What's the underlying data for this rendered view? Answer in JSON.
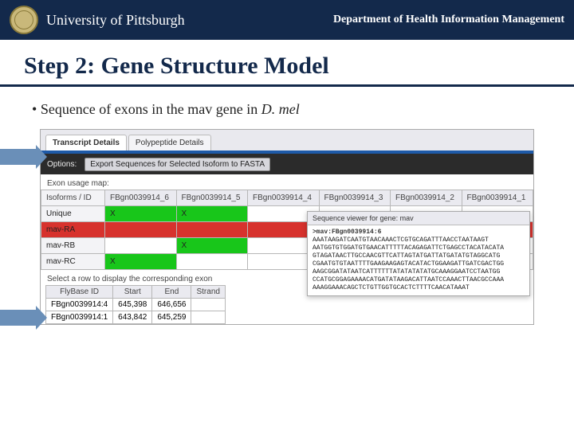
{
  "header": {
    "university": "University of Pittsburgh",
    "department": "Department of Health Information Management"
  },
  "slide": {
    "title": "Step 2: Gene Structure Model",
    "bullet_prefix": "• ",
    "bullet_text": "Sequence of exons in the mav gene in ",
    "bullet_italic": "D. mel"
  },
  "panel": {
    "tabs": {
      "active": "Transcript Details",
      "other": "Polypeptide Details"
    },
    "options_label": "Options:",
    "options_button": "Export Sequences for Selected Isoform to FASTA",
    "exon_map_label": "Exon usage map:",
    "columns": {
      "c0": "Isoforms / ID",
      "c1": "FBgn0039914_6",
      "c2": "FBgn0039914_5",
      "c3": "FBgn0039914_4",
      "c4": "FBgn0039914_3",
      "c5": "FBgn0039914_2",
      "c6": "FBgn0039914_1"
    },
    "rows": {
      "unique": "Unique",
      "ra": "mav-RA",
      "rb": "mav-RB",
      "rc": "mav-RC"
    },
    "marks": {
      "x": "X"
    },
    "select_label": "Select a row to display the corresponding exon",
    "sub": {
      "h1": "FlyBase ID",
      "h2": "Start",
      "h3": "End",
      "h4": "Strand",
      "r1c1": "FBgn0039914:4",
      "r1c2": "645,398",
      "r1c3": "646,656",
      "r2c1": "FBgn0039914:1",
      "r2c2": "643,842",
      "r2c3": "645,259"
    },
    "viewer": {
      "title": "Sequence viewer for gene: mav",
      "fasta_header": ">mav:FBgn0039914:6",
      "l1": "AAATAAGATCAATGTAACAAACTCGTGCAGATTTAACCTAATAAGT",
      "l2": "AATGGTGTGGATGTGAACATTTTTACAGAGATTCTGAGCCTACATACATA",
      "l3": "GTAGATAACTTGCCAACGTTCATTAGTATGATTATGATATGTAGGCATG",
      "l4": "CGAATGTGTAATTTTGAAGAAGAGTACATACTGGAAGATTGATCGACTGG",
      "l5": "AAGCGGATATAATCATTTTTTATATATATATGCAAAGGAATCCTAATGG",
      "l6": "CCATGCGGAGAAAACATGATATAAGACATTAATCCAAACTTAACGCCAAA",
      "l7": "AAAGGAAACAGCTCTGTTGGTGCACTCTTTTCAACATAAAT"
    }
  }
}
